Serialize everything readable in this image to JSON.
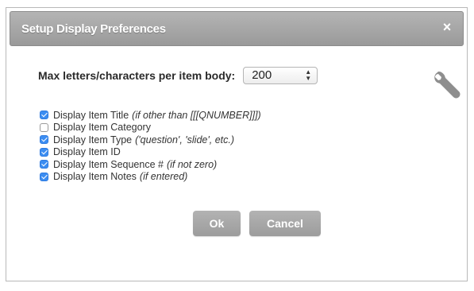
{
  "dialog": {
    "title": "Setup Display Preferences",
    "close_glyph": "×"
  },
  "max_chars": {
    "label": "Max letters/characters per item body:",
    "value": "200"
  },
  "options": [
    {
      "label": "Display Item Title",
      "note": "(if other than [[[QNUMBER]]])",
      "checked": true
    },
    {
      "label": "Display Item Category",
      "note": "",
      "checked": false
    },
    {
      "label": "Display Item Type",
      "note": "('question', 'slide', etc.)",
      "checked": true
    },
    {
      "label": "Display Item ID",
      "note": "",
      "checked": true
    },
    {
      "label": "Display Item Sequence #",
      "note": "(if not zero)",
      "checked": true
    },
    {
      "label": "Display Item Notes",
      "note": "(if entered)",
      "checked": true
    }
  ],
  "buttons": {
    "ok": "Ok",
    "cancel": "Cancel"
  },
  "icons": {
    "settings": "wrench-icon",
    "close": "close-icon",
    "select_arrows": "select-arrows-icon"
  },
  "colors": {
    "titlebar": "#a6a6a6",
    "checkbox_checked": "#3c8df1",
    "button": "#a8a8a8"
  }
}
